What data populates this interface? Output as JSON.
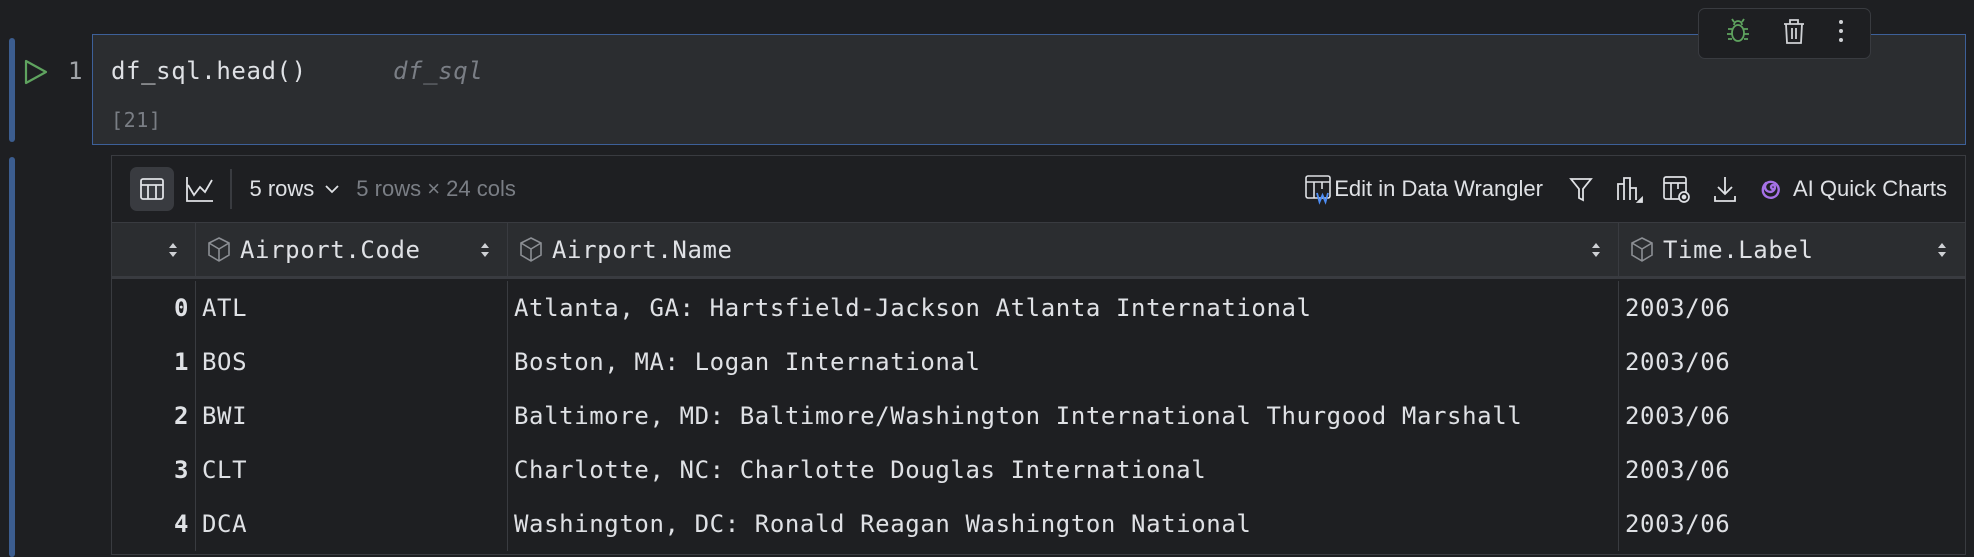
{
  "cell": {
    "line_number": "1",
    "code": "df_sql.head()",
    "inline_hint": "df_sql",
    "execution_count": "[21]"
  },
  "cell_toolbar": {
    "icons": [
      "bug-icon",
      "trash-icon",
      "more-vertical-icon"
    ]
  },
  "output_toolbar": {
    "rows_selector": "5 rows",
    "shape": "5 rows × 24 cols",
    "edit_wrangler": "Edit in Data Wrangler",
    "ai_charts": "AI Quick Charts"
  },
  "table": {
    "columns": [
      "Airport.Code",
      "Airport.Name",
      "Time.Label"
    ],
    "rows": [
      {
        "index": "0",
        "code": "ATL",
        "name": "Atlanta, GA: Hartsfield-Jackson Atlanta International",
        "time": "2003/06"
      },
      {
        "index": "1",
        "code": "BOS",
        "name": "Boston, MA: Logan International",
        "time": "2003/06"
      },
      {
        "index": "2",
        "code": "BWI",
        "name": "Baltimore, MD: Baltimore/Washington International Thurgood Marshall",
        "time": "2003/06"
      },
      {
        "index": "3",
        "code": "CLT",
        "name": "Charlotte, NC: Charlotte Douglas International",
        "time": "2003/06"
      },
      {
        "index": "4",
        "code": "DCA",
        "name": "Washington, DC: Ronald Reagan Washington National",
        "time": "2003/06"
      }
    ]
  },
  "colors": {
    "accent": "#3d6099",
    "run": "#5fa35f",
    "ai": "#a571e6",
    "wrangler_w": "#4d8df5"
  }
}
